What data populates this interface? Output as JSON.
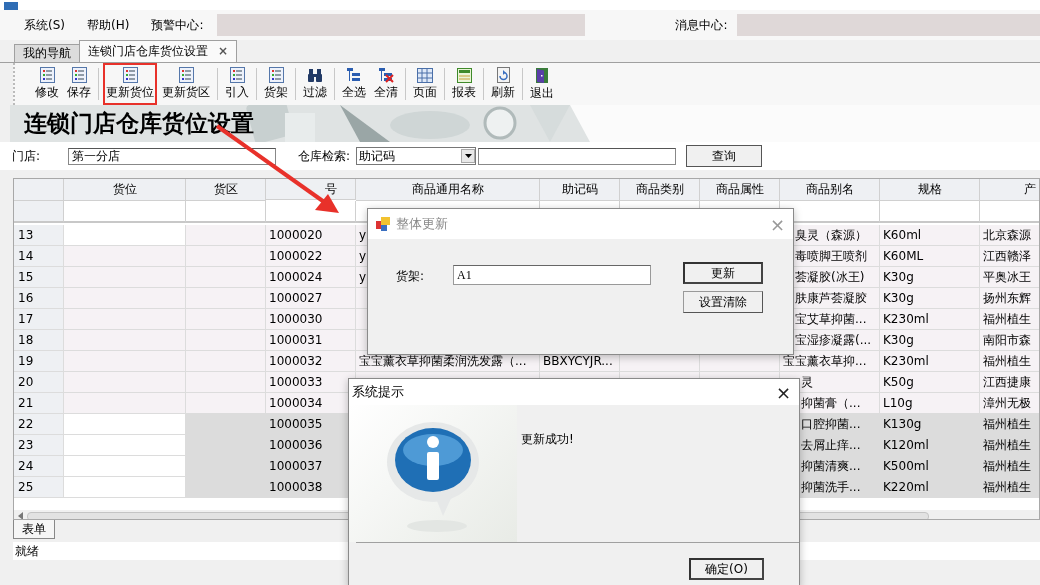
{
  "menu": [
    {
      "label": "系统(S)"
    },
    {
      "label": "帮助(H)"
    }
  ],
  "alert_center": {
    "label": "预警中心:"
  },
  "message_center": {
    "label": "消息中心:"
  },
  "tabs": [
    {
      "label": "我的导航",
      "selected": false
    },
    {
      "label": "连锁门店仓库货位设置",
      "selected": true,
      "close": "×"
    }
  ],
  "toolbar": [
    {
      "label": "修改",
      "highlighted": false
    },
    {
      "label": "保存",
      "highlighted": false
    },
    {
      "label": "更新货位",
      "highlighted": true
    },
    {
      "label": "更新货区",
      "highlighted": false
    },
    {
      "label": "引入",
      "highlighted": false
    },
    {
      "label": "货架",
      "highlighted": false
    },
    {
      "label": "过滤",
      "highlighted": false
    },
    {
      "label": "全选",
      "highlighted": false
    },
    {
      "label": "全清",
      "highlighted": false
    },
    {
      "label": "页面",
      "highlighted": false
    },
    {
      "label": "报表",
      "highlighted": false
    },
    {
      "label": "刷新",
      "highlighted": false
    },
    {
      "label": "退出",
      "highlighted": false
    }
  ],
  "banner": {
    "title": "连锁门店仓库货位设置"
  },
  "filter": {
    "store_label": "门店:",
    "store_value": "第一分店",
    "search_label": "仓库检索:",
    "search_mode": "助记码",
    "query_button": "查询"
  },
  "table": {
    "columns": [
      "货位",
      "货区",
      "号",
      "商品通用名称",
      "助记码",
      "商品类别",
      "商品属性",
      "商品别名",
      "规格",
      "产"
    ],
    "rows": [
      {
        "number": "13",
        "item_no": "1000020",
        "name": "y",
        "alias": "臭灵（森源）",
        "spec": "K60ml",
        "origin": "北京森源",
        "selected": false
      },
      {
        "number": "14",
        "item_no": "1000022",
        "name": "y",
        "alias": "毒喷脚王喷剂",
        "spec": "K60ML",
        "origin": "江西赣泽",
        "selected": false
      },
      {
        "number": "15",
        "item_no": "1000024",
        "name": "y",
        "alias": "荟凝胶(冰王)",
        "spec": "K30g",
        "origin": "平奥冰王",
        "selected": false
      },
      {
        "number": "16",
        "item_no": "1000027",
        "alias": "肤康芦荟凝胶",
        "spec": "K30g",
        "origin": "扬州东辉",
        "selected": false
      },
      {
        "number": "17",
        "item_no": "1000030",
        "alias": "宝艾草抑菌...",
        "spec": "K230ml",
        "origin": "福州植生",
        "selected": false
      },
      {
        "number": "18",
        "item_no": "1000031",
        "alias": "宝湿疹凝露(...",
        "spec": "K30g",
        "origin": "南阳市森",
        "selected": false
      },
      {
        "number": "19",
        "item_no": "1000032",
        "name": "宝宝薰衣草抑菌柔润洗发露（...",
        "code": "BBXYCYJR...",
        "alias": "宝宝薰衣草抑...",
        "spec": "K230ml",
        "origin": "福州植生",
        "selected": false
      },
      {
        "number": "20",
        "item_no": "1000033",
        "alias": "灵",
        "spec": "K50g",
        "origin": "江西捷康",
        "selected": false
      },
      {
        "number": "21",
        "item_no": "1000034",
        "alias": "抑菌膏（...",
        "spec": "L10g",
        "origin": "漳州无极",
        "selected": false
      },
      {
        "number": "22",
        "item_no": "1000035",
        "alias": "口腔抑菌...",
        "spec": "K130g",
        "origin": "福州植生",
        "selected": true
      },
      {
        "number": "23",
        "item_no": "1000036",
        "alias": "去屑止痒...",
        "spec": "K120ml",
        "origin": "福州植生",
        "selected": true
      },
      {
        "number": "24",
        "item_no": "1000037",
        "alias": "抑菌清爽...",
        "spec": "K500ml",
        "origin": "福州植生",
        "selected": true
      },
      {
        "number": "25",
        "item_no": "1000038",
        "alias": "抑菌洗手...",
        "spec": "K220ml",
        "origin": "福州植生",
        "selected": true
      }
    ]
  },
  "bottom_tabs": [
    {
      "label": "表单",
      "selected": true
    }
  ],
  "status_bar": "就绪",
  "update_dialog": {
    "title": "整体更新",
    "close": "×",
    "field_label": "货架:",
    "field_value": "A1",
    "buttons": [
      "更新",
      "设置清除"
    ]
  },
  "message_dialog": {
    "title": "系统提示",
    "close": "×",
    "message": "更新成功!",
    "button": "确定(O)"
  }
}
